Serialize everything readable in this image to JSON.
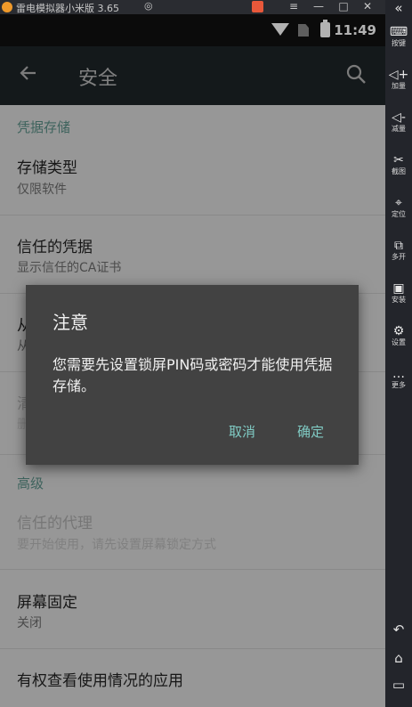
{
  "emulator": {
    "title": "雷电模拟器小米版 3.65",
    "window_buttons": [
      "≡",
      "—",
      "□",
      "✕"
    ],
    "collapse": "«"
  },
  "status_bar": {
    "time": "11:49"
  },
  "app_bar": {
    "title": "安全",
    "back_icon": "arrow-back-icon",
    "search_icon": "search-icon"
  },
  "settings": {
    "section_credential": "凭据存储",
    "storage_type": {
      "title": "存储类型",
      "subtitle": "仅限软件"
    },
    "trusted_credentials": {
      "title": "信任的凭据",
      "subtitle": "显示信任的CA证书"
    },
    "install_partial": {
      "title": "从",
      "subtitle": "从"
    },
    "clear_partial": {
      "title": "清",
      "subtitle": "删"
    },
    "section_advanced": "高级",
    "trust_agents": {
      "title": "信任的代理",
      "subtitle": "要开始使用，请先设置屏幕锁定方式"
    },
    "screen_pinning": {
      "title": "屏幕固定",
      "subtitle": "关闭"
    },
    "usage_access": {
      "title": "有权查看使用情况的应用"
    }
  },
  "dialog": {
    "title": "注意",
    "message": "您需要先设置锁屏PIN码或密码才能使用凭据存储。",
    "cancel": "取消",
    "ok": "确定"
  },
  "sidebar": [
    {
      "label": "按键",
      "icon": "keyboard-icon"
    },
    {
      "label": "加量",
      "icon": "volume-up-icon"
    },
    {
      "label": "减量",
      "icon": "volume-down-icon"
    },
    {
      "label": "截图",
      "icon": "scissors-icon"
    },
    {
      "label": "定位",
      "icon": "location-pin-icon"
    },
    {
      "label": "多开",
      "icon": "multi-instance-icon"
    },
    {
      "label": "安装",
      "icon": "apk-install-icon"
    },
    {
      "label": "设置",
      "icon": "gear-icon"
    },
    {
      "label": "更多",
      "icon": "more-dots-icon"
    }
  ],
  "colors": {
    "accent": "#80cbc4",
    "section": "#5a8f86",
    "dialog_bg": "#424242",
    "page_bg": "#d9d9d9"
  }
}
